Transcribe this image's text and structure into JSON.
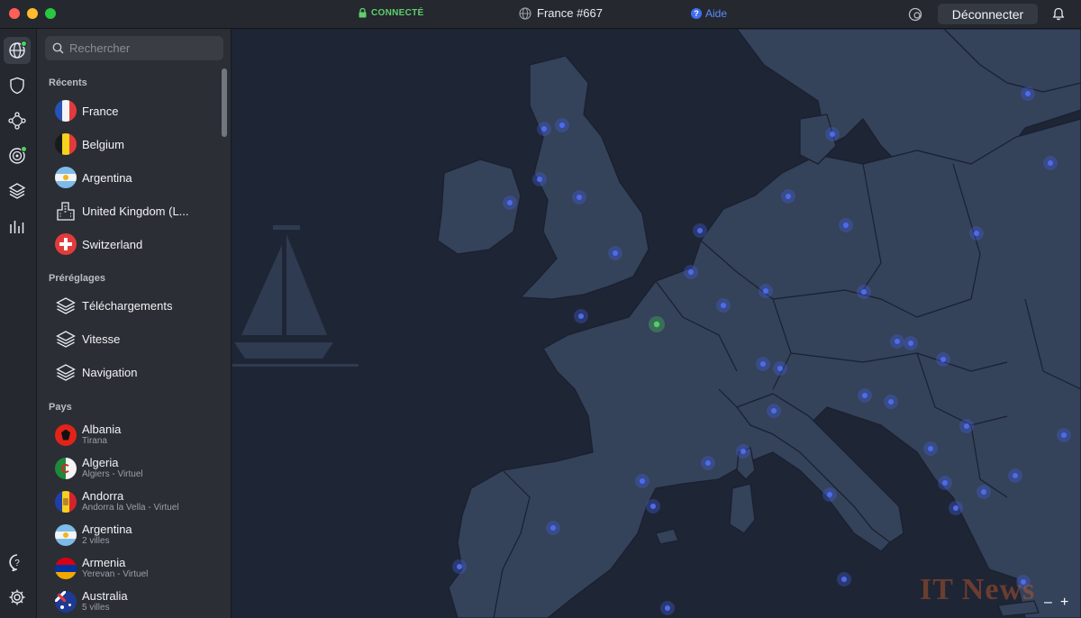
{
  "titlebar": {
    "status": "CONNECTÉ",
    "server": "France #667",
    "help": "Aide",
    "disconnect": "Déconnecter"
  },
  "rail": {
    "icons": [
      "globe-icon",
      "shield-icon",
      "meshnet-icon",
      "target-icon",
      "layers-icon",
      "stats-icon",
      "help-icon",
      "settings-icon"
    ]
  },
  "search": {
    "placeholder": "Rechercher"
  },
  "recents": {
    "title": "Récents",
    "items": [
      {
        "label": "France",
        "flag": "france"
      },
      {
        "label": "Belgium",
        "flag": "belgium"
      },
      {
        "label": "Argentina",
        "flag": "argentina"
      },
      {
        "label": "United Kingdom (L...",
        "flag": "building"
      },
      {
        "label": "Switzerland",
        "flag": "switzerland"
      }
    ]
  },
  "presets": {
    "title": "Préréglages",
    "items": [
      {
        "label": "Téléchargements"
      },
      {
        "label": "Vitesse"
      },
      {
        "label": "Navigation"
      }
    ]
  },
  "countries": {
    "title": "Pays",
    "items": [
      {
        "label": "Albania",
        "sub": "Tirana",
        "flag": "albania"
      },
      {
        "label": "Algeria",
        "sub": "Algiers - Virtuel",
        "flag": "algeria"
      },
      {
        "label": "Andorra",
        "sub": "Andorra la Vella - Virtuel",
        "flag": "andorra"
      },
      {
        "label": "Argentina",
        "sub": "2 villes",
        "flag": "argentina"
      },
      {
        "label": "Armenia",
        "sub": "Yerevan - Virtuel",
        "flag": "armenia"
      },
      {
        "label": "Australia",
        "sub": "5 villes",
        "flag": "australia"
      }
    ]
  },
  "map": {
    "watermark": "IT News",
    "zoom_out": "–",
    "zoom_in": "+"
  },
  "colors": {
    "accent": "#3f6ef5",
    "connected": "#50d15f",
    "ocean": "#1e2535",
    "land": "#34425a"
  }
}
